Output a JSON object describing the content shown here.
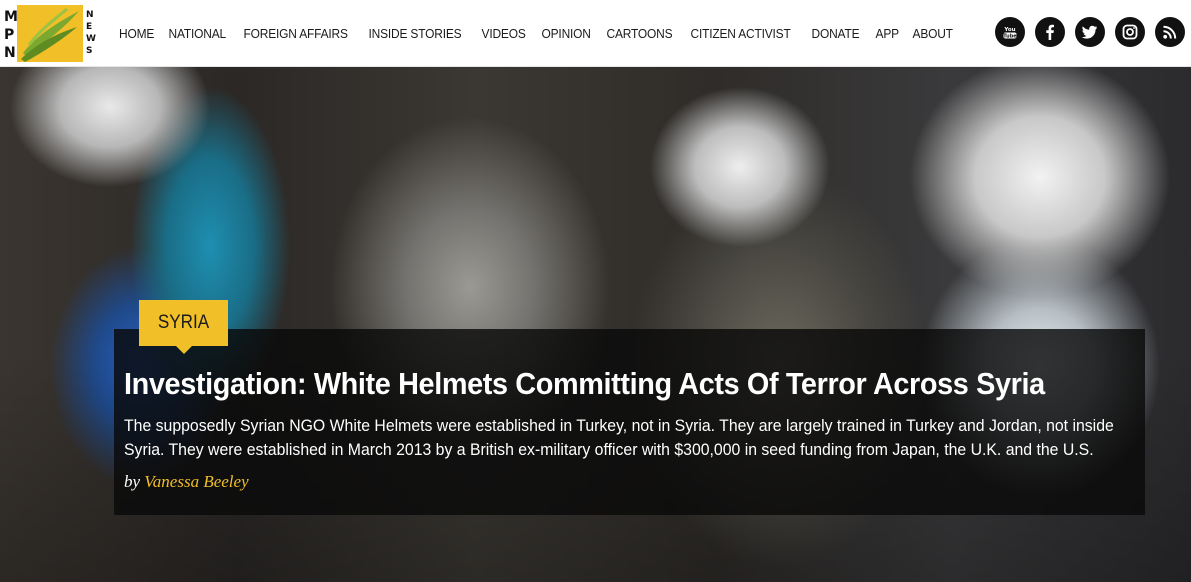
{
  "logo": {
    "letters": [
      "M",
      "P",
      "N"
    ],
    "news": [
      "N",
      "E",
      "W",
      "S"
    ],
    "accent": "#f1bf27"
  },
  "nav": {
    "items": [
      {
        "label": "HOME"
      },
      {
        "label": "NATIONAL"
      },
      {
        "label": "FOREIGN AFFAIRS"
      },
      {
        "label": "INSIDE STORIES"
      },
      {
        "label": "VIDEOS"
      },
      {
        "label": "OPINION"
      },
      {
        "label": "CARTOONS"
      },
      {
        "label": "CITIZEN ACTIVIST"
      },
      {
        "label": "DONATE"
      },
      {
        "label": "APP"
      },
      {
        "label": "ABOUT"
      }
    ]
  },
  "social": {
    "icons": [
      "youtube-icon",
      "facebook-icon",
      "twitter-icon",
      "instagram-icon",
      "rss-icon"
    ],
    "youtube_text": "You Tube"
  },
  "hero": {
    "category": "SYRIA",
    "headline": "Investigation: White Helmets Committing Acts Of Terror Across Syria",
    "excerpt": "The supposedly Syrian NGO White Helmets were established in Turkey, not in Syria. They are largely trained in Turkey and Jordan, not inside Syria. They were established in March 2013 by a British ex-military officer with $300,000 in seed funding from Japan, the U.K. and the U.S.",
    "byline_prefix": "by",
    "author": "Vanessa Beeley"
  },
  "colors": {
    "accent": "#f1bf27",
    "card": "#0a0a0a"
  }
}
